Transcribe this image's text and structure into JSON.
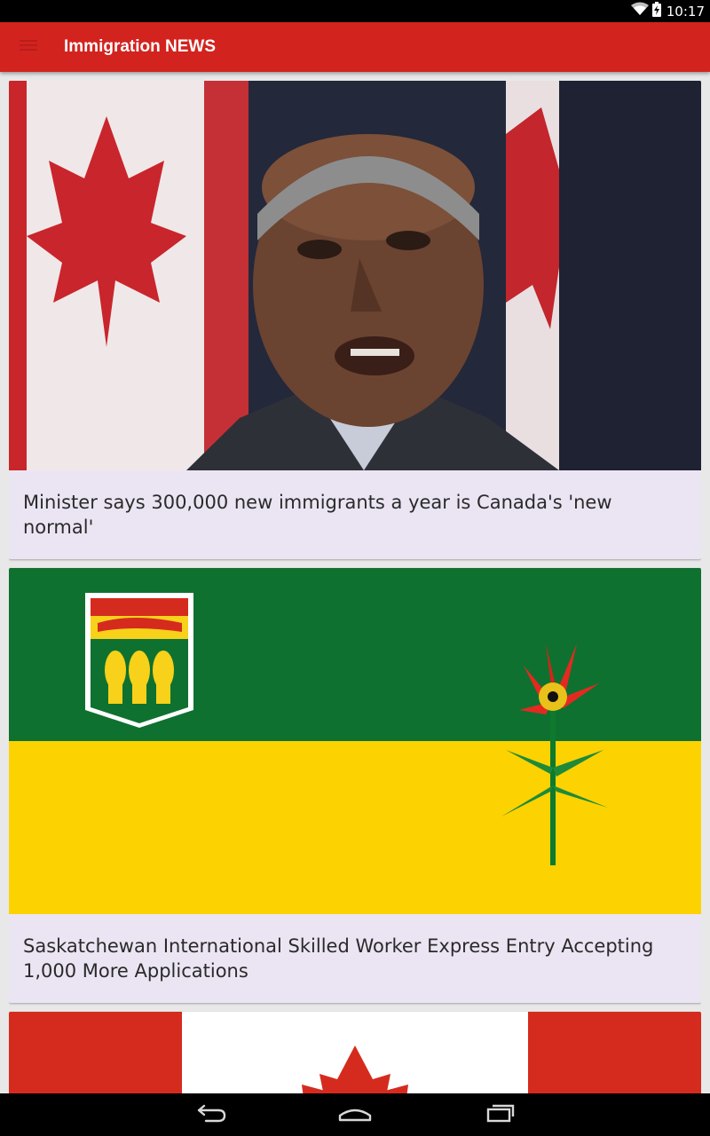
{
  "status_bar": {
    "time": "10:17",
    "icons": [
      "wifi-icon",
      "battery-charging-icon"
    ],
    "background": "#000000"
  },
  "app_bar": {
    "title": "Immigration NEWS",
    "menu_icon": "hamburger-menu-icon",
    "color": "#d3231f"
  },
  "feed": {
    "items": [
      {
        "title": "Minister says 300,000 new immigrants a year is Canada's 'new normal'",
        "image": "photo of a man speaking in front of Canadian flags"
      },
      {
        "title": "Saskatchewan International Skilled Worker Express Entry Accepting 1,000 More Applications",
        "image": "flag of Saskatchewan"
      },
      {
        "title": "",
        "image": "flag of Canada"
      }
    ]
  },
  "nav_bar": {
    "buttons": [
      "back-icon",
      "home-icon",
      "recents-icon"
    ]
  },
  "colors": {
    "card_background": "#ebe5f3",
    "canada_red": "#d52b1e",
    "sask_green": "#0f7130",
    "sask_yellow": "#fcd200"
  }
}
